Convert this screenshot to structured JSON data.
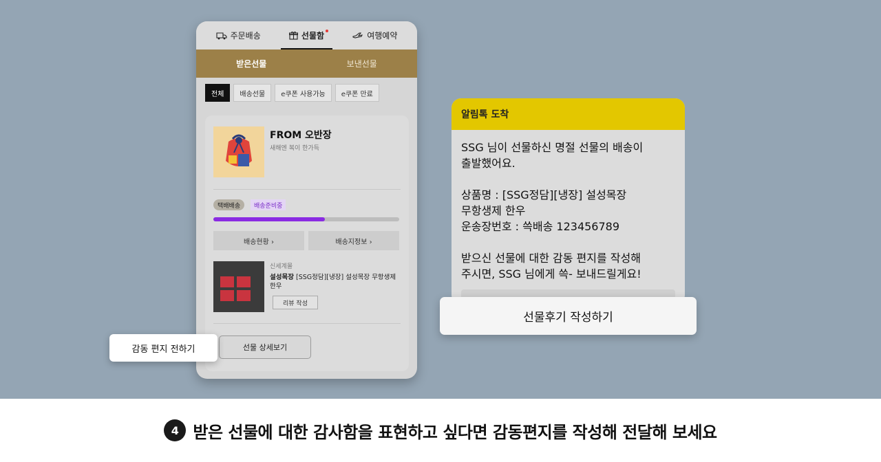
{
  "top_tabs": [
    {
      "label": "주문배송",
      "icon": "truck-icon"
    },
    {
      "label": "선물함",
      "icon": "gift-icon",
      "active": true,
      "new_dot": true
    },
    {
      "label": "여행예약",
      "icon": "airplane-icon"
    }
  ],
  "sub_tabs": [
    {
      "label": "받은선물",
      "active": true
    },
    {
      "label": "보낸선물"
    }
  ],
  "filters": [
    {
      "label": "전체",
      "active": true
    },
    {
      "label": "배송선물"
    },
    {
      "label": "e쿠폰 사용가능"
    },
    {
      "label": "e쿠폰 만료"
    }
  ],
  "gift_card": {
    "from": "FROM 오반장",
    "message": "새해엔 복이 한가득",
    "ship_badge": "택배배송",
    "status_badge": "배송준비중",
    "progress": 0.6,
    "actions": [
      "배송현황 ›",
      "배송지정보 ›"
    ],
    "product": {
      "brand": "신세계몰",
      "name_bold": "설성목장",
      "name_rest": " [SSG정담][냉장] 설성목장 무항생제 한우",
      "review_label": "리뷰 작성"
    },
    "detail_label": "선물 상세보기",
    "letter_label": "감동 편지 전하기"
  },
  "alimtalk": {
    "header": "알림톡 도착",
    "lines": [
      "SSG 님이 선물하신 명절 선물의 배송이",
      "출발했어요.",
      "",
      "상품명 : [SSG정담][냉장] 설성목장",
      "무항생제 한우",
      "운송장번호 : 쓱배송 123456789",
      "",
      "받으신 선물에 대한 감동 편지를 작성해",
      "주시면, SSG 님에게 쓱- 보내드릴게요!"
    ],
    "cta": "선물후기 작성하기"
  },
  "caption": {
    "step": "4",
    "text": "받은 선물에 대한 감사함을 표현하고 싶다면 감동편지를 작성해 전달해 보세요"
  },
  "colors": {
    "background": "#94a5b4",
    "sub_tab_bar": "#9c8048",
    "alim_header": "#e3c700",
    "progress": "#8a2be2"
  }
}
